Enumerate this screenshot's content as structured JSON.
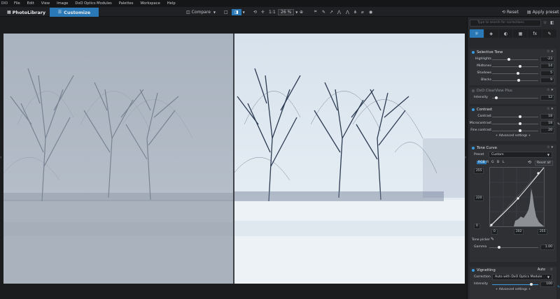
{
  "menubar": {
    "logo": "DXO",
    "items": [
      "File",
      "Edit",
      "View",
      "Image",
      "DxO Optics Modules",
      "Palettes",
      "Workspace",
      "Help"
    ]
  },
  "toolbar": {
    "photolibrary": "PhotoLibrary",
    "customize": "Customize",
    "compare": "Compare",
    "ratio": "1:1",
    "zoom": "26 %",
    "reset": "Reset",
    "apply_preset": "Apply preset"
  },
  "panel": {
    "search_placeholder": "Type to search for corrections",
    "tabs": [
      "☼",
      "◈",
      "◐",
      "▦",
      "fx",
      "✎"
    ],
    "selective_tone": {
      "title": "Selective Tone",
      "rows": [
        {
          "label": "Highlights",
          "value": "-23"
        },
        {
          "label": "Midtones",
          "value": "14"
        },
        {
          "label": "Shadows",
          "value": "5"
        },
        {
          "label": "Blacks",
          "value": "9"
        }
      ]
    },
    "clearview": {
      "title": "DxO ClearView Plus",
      "label": "Intensity",
      "value": "12"
    },
    "contrast": {
      "title": "Contrast",
      "rows": [
        {
          "label": "Contrast",
          "value": "18"
        },
        {
          "label": "Microcontrast",
          "value": "18"
        },
        {
          "label": "Fine contrast",
          "value": "20"
        }
      ],
      "advanced": "+ Advanced settings +"
    },
    "tone_curve": {
      "title": "Tone Curve",
      "preset_label": "Preset",
      "preset_value": "Custom",
      "channels": [
        "RGB",
        "R",
        "G",
        "B",
        "L"
      ],
      "reset_all": "Reset all",
      "y_top": "255",
      "y_mid": "220",
      "y_bottom": "0",
      "x_left": "0",
      "x_mid": "202",
      "x_right": "255",
      "tone_picker": "Tone picker",
      "gamma_label": "Gamma",
      "gamma_value": "1.00"
    },
    "vignetting": {
      "title": "Vignetting",
      "mode": "Auto",
      "correction_label": "Correction",
      "correction_value": "Auto with DxO Optics Module",
      "intensity_label": "Intensity",
      "intensity_value": "100",
      "advanced": "+ Advanced settings +"
    }
  }
}
